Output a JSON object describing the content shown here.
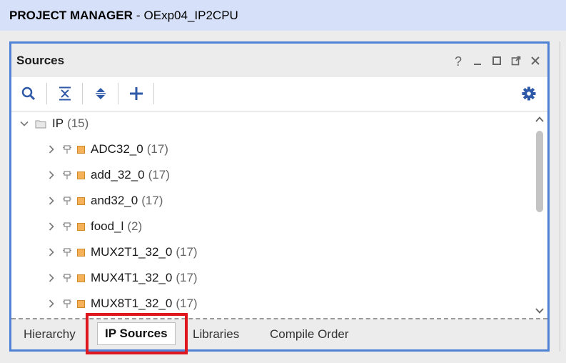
{
  "header": {
    "title": "PROJECT MANAGER",
    "separator": "-",
    "project": "OExp04_IP2CPU"
  },
  "panel": {
    "title": "Sources",
    "controls": [
      "?",
      "minimize",
      "restore",
      "float",
      "close"
    ]
  },
  "toolbar": {
    "buttons": [
      "search-icon",
      "collapse-all-icon",
      "expand-all-icon",
      "add-icon"
    ],
    "settings": "gear-icon"
  },
  "tree": {
    "root": {
      "label": "IP",
      "count": "(15)"
    },
    "items": [
      {
        "label": "ADC32_0",
        "count": "(17)"
      },
      {
        "label": "add_32_0",
        "count": "(17)"
      },
      {
        "label": "and32_0",
        "count": "(17)"
      },
      {
        "label": "food_l",
        "count": "(2)"
      },
      {
        "label": "MUX2T1_32_0",
        "count": "(17)"
      },
      {
        "label": "MUX4T1_32_0",
        "count": "(17)"
      },
      {
        "label": "MUX8T1_32_0",
        "count": "(17)"
      }
    ]
  },
  "tabs": [
    {
      "label": "Hierarchy",
      "active": false
    },
    {
      "label": "IP Sources",
      "active": true
    },
    {
      "label": "Libraries",
      "active": false
    },
    {
      "label": "Compile Order",
      "active": false
    }
  ],
  "colors": {
    "panel_border": "#4f81d4",
    "highlight": "#e0161e",
    "ip_icon": "#f6b25a",
    "accent": "#2f5aa8"
  }
}
